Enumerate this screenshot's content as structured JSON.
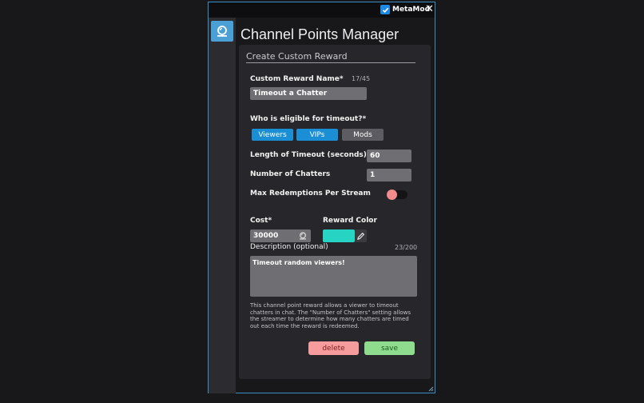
{
  "window": {
    "brand_name": "MetaMod",
    "close_label": "✕"
  },
  "page": {
    "title": "Channel Points Manager"
  },
  "form": {
    "section_title": "Create Custom Reward",
    "reward_name": {
      "label": "Custom Reward Name*",
      "counter": "17/45",
      "value": "Timeout a Chatter"
    },
    "eligibility": {
      "label": "Who is eligible for timeout?*",
      "options": [
        {
          "label": "Viewers",
          "selected": true
        },
        {
          "label": "VIPs",
          "selected": true
        },
        {
          "label": "Mods",
          "selected": false
        }
      ]
    },
    "timeout_length": {
      "label": "Length of Timeout (seconds)",
      "value": "60"
    },
    "num_chatters": {
      "label": "Number of Chatters",
      "value": "1"
    },
    "max_redemptions": {
      "label": "Max Redemptions Per Stream",
      "enabled": false
    },
    "cost": {
      "label": "Cost*",
      "value": "30000"
    },
    "reward_color": {
      "label": "Reward Color",
      "value": "#27d4c3"
    },
    "description": {
      "label": "Description (optional)",
      "counter": "23/200",
      "value": "Timeout random viewers!"
    },
    "help_text": "This channel point reward allows a viewer to timeout chatters in chat. The \"Number of Chatters\" setting allows the streamer to determine how many chatters are timed out each time the reward is redeemed.",
    "delete_label": "delete",
    "save_label": "save"
  },
  "colors": {
    "accent": "#1b8fd6",
    "window_border": "#3b8fc7",
    "delete": "#f79c9c",
    "save": "#8fdc8f",
    "toggle_off": "#f28b8b"
  },
  "icons": {
    "brand": "checkmark-icon",
    "app": "channel-points-icon",
    "cost": "channel-points-icon",
    "picker": "pencil-icon"
  }
}
